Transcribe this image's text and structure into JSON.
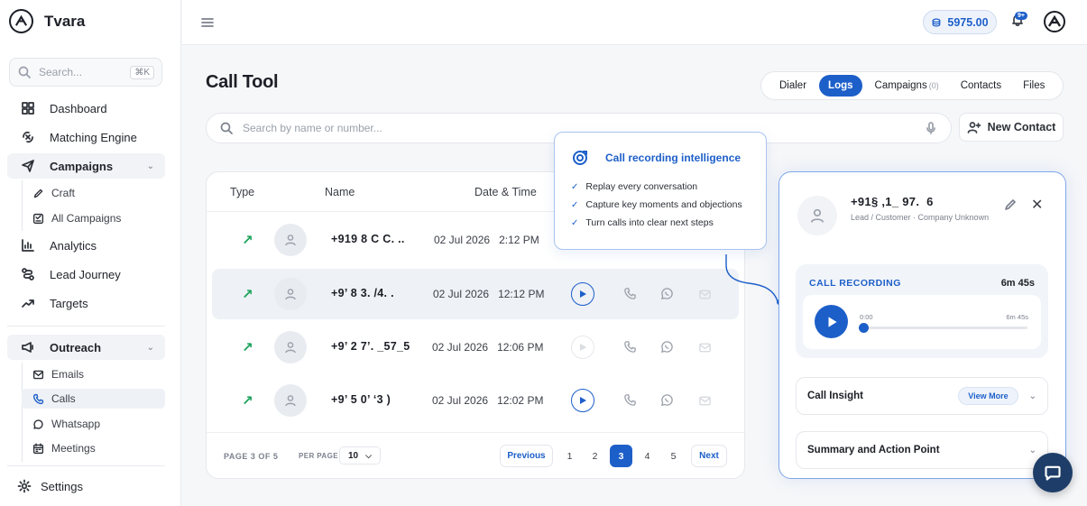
{
  "app": {
    "name": "Tvara"
  },
  "sidebar": {
    "search_placeholder": "Search...",
    "search_shortcut": "⌘K",
    "items": [
      {
        "label": "Dashboard",
        "icon": "grid-icon"
      },
      {
        "label": "Matching Engine",
        "icon": "matching-icon"
      },
      {
        "label": "Campaigns",
        "icon": "send-icon",
        "expanded": true,
        "children": [
          {
            "label": "Craft",
            "icon": "pen-icon"
          },
          {
            "label": "All Campaigns",
            "icon": "list-check-icon"
          }
        ]
      },
      {
        "label": "Analytics",
        "icon": "bar-chart-icon"
      },
      {
        "label": "Lead Journey",
        "icon": "route-icon"
      },
      {
        "label": "Targets",
        "icon": "trend-icon"
      },
      {
        "label": "Outreach",
        "icon": "megaphone-icon",
        "expanded": true,
        "children": [
          {
            "label": "Emails",
            "icon": "mail-icon"
          },
          {
            "label": "Calls",
            "icon": "phone-icon",
            "active": true
          },
          {
            "label": "Whatsapp",
            "icon": "chat-bubble-icon"
          },
          {
            "label": "Meetings",
            "icon": "calendar-icon"
          }
        ]
      }
    ],
    "settings_label": "Settings"
  },
  "topbar": {
    "credits": "5975.00",
    "notification_badge": "9+"
  },
  "main": {
    "title": "Call Tool",
    "tabs": [
      {
        "label": "Dialer"
      },
      {
        "label": "Logs",
        "active": true
      },
      {
        "label": "Campaigns",
        "count": "(0)"
      },
      {
        "label": "Contacts"
      },
      {
        "label": "Files"
      }
    ],
    "search_placeholder": "Search by name or number...",
    "new_contact_label": "New Contact"
  },
  "table": {
    "columns": [
      "Type",
      "Name",
      "Date & Time"
    ],
    "rows": [
      {
        "type": "outgoing",
        "phone": "+919  8  C  C.  ..   ",
        "date": "02 Jul 2026",
        "time": "2:12 PM",
        "has_recording": false
      },
      {
        "type": "outgoing",
        "phone": "+9’  8  3.  /4.  .  ",
        "date": "02 Jul 2026",
        "time": "12:12 PM",
        "has_recording": true
      },
      {
        "type": "outgoing",
        "phone": "+9’  2  7’. _57_5",
        "date": "02 Jul 2026",
        "time": "12:06 PM",
        "has_recording": false
      },
      {
        "type": "outgoing",
        "phone": "+9’  5  0’  ‘3     )",
        "date": "02 Jul 2026",
        "time": "12:02 PM",
        "has_recording": true
      }
    ],
    "pagination": {
      "page_info": "PAGE 3 OF 5",
      "per_page_label": "PER PAGE",
      "per_page_value": "10",
      "previous_label": "Previous",
      "next_label": "Next",
      "pages": [
        "1",
        "2",
        "3",
        "4",
        "5"
      ],
      "current_page": "3"
    }
  },
  "intelligence": {
    "title": "Call recording intelligence",
    "points": [
      "Replay every conversation",
      "Capture key moments and objections",
      "Turn calls into clear next steps"
    ]
  },
  "detail": {
    "phone": "+91§ ,1_ 97.  6",
    "subtitle": "Lead / Customer · Company Unknown",
    "recording": {
      "label": "CALL RECORDING",
      "duration": "6m 45s",
      "current": "0:00",
      "total": "6m 45s",
      "progress": 0
    },
    "insight_label": "Call Insight",
    "view_more_label": "View More",
    "summary_label": "Summary and Action Point"
  },
  "colors": {
    "accent": "#1d5fc9",
    "incoming_arrow": "#1aa35a",
    "chat_fab": "#1e3d68"
  }
}
